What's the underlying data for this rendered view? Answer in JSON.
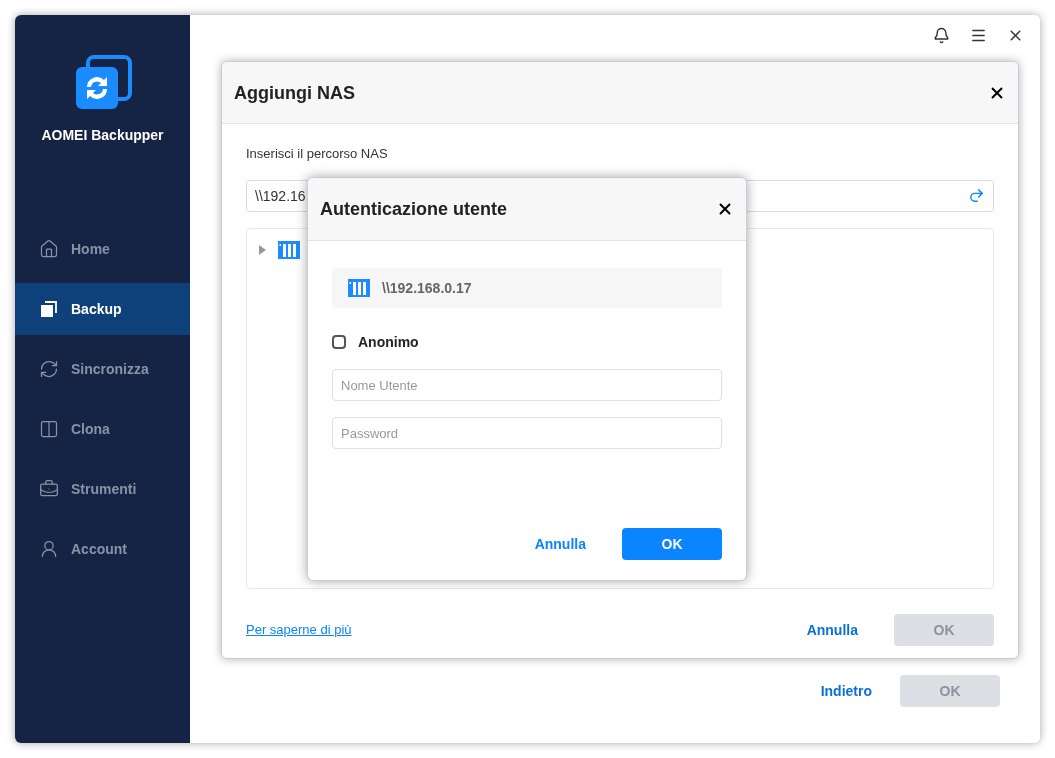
{
  "app": {
    "name": "AOMEI Backupper"
  },
  "sidebar": {
    "items": [
      {
        "label": "Home",
        "kind": "home",
        "selected": false
      },
      {
        "label": "Backup",
        "kind": "backup",
        "selected": true
      },
      {
        "label": "Sincronizza",
        "kind": "sync",
        "selected": false
      },
      {
        "label": "Clona",
        "kind": "clone",
        "selected": false
      },
      {
        "label": "Strumenti",
        "kind": "tools",
        "selected": false
      },
      {
        "label": "Account",
        "kind": "account",
        "selected": false
      }
    ]
  },
  "footer": {
    "back": "Indietro",
    "ok": {
      "label": "OK",
      "disabled": true
    }
  },
  "nas_dialog": {
    "title": "Aggiungi NAS",
    "path_label": "Inserisci il percorso NAS",
    "path_value": "\\\\192.16",
    "tree": [
      {
        "expanded": false
      }
    ],
    "link": "Per saperne di più",
    "cancel": "Annulla",
    "ok": {
      "label": "OK",
      "disabled": true
    }
  },
  "auth_dialog": {
    "title": "Autenticazione utente",
    "server": "\\\\192.168.0.17",
    "anonymous": {
      "label": "Anonimo",
      "checked": false
    },
    "username": {
      "placeholder": "Nome Utente"
    },
    "password": {
      "placeholder": "Password"
    },
    "cancel": "Annulla",
    "ok": {
      "label": "OK",
      "disabled": false
    }
  }
}
